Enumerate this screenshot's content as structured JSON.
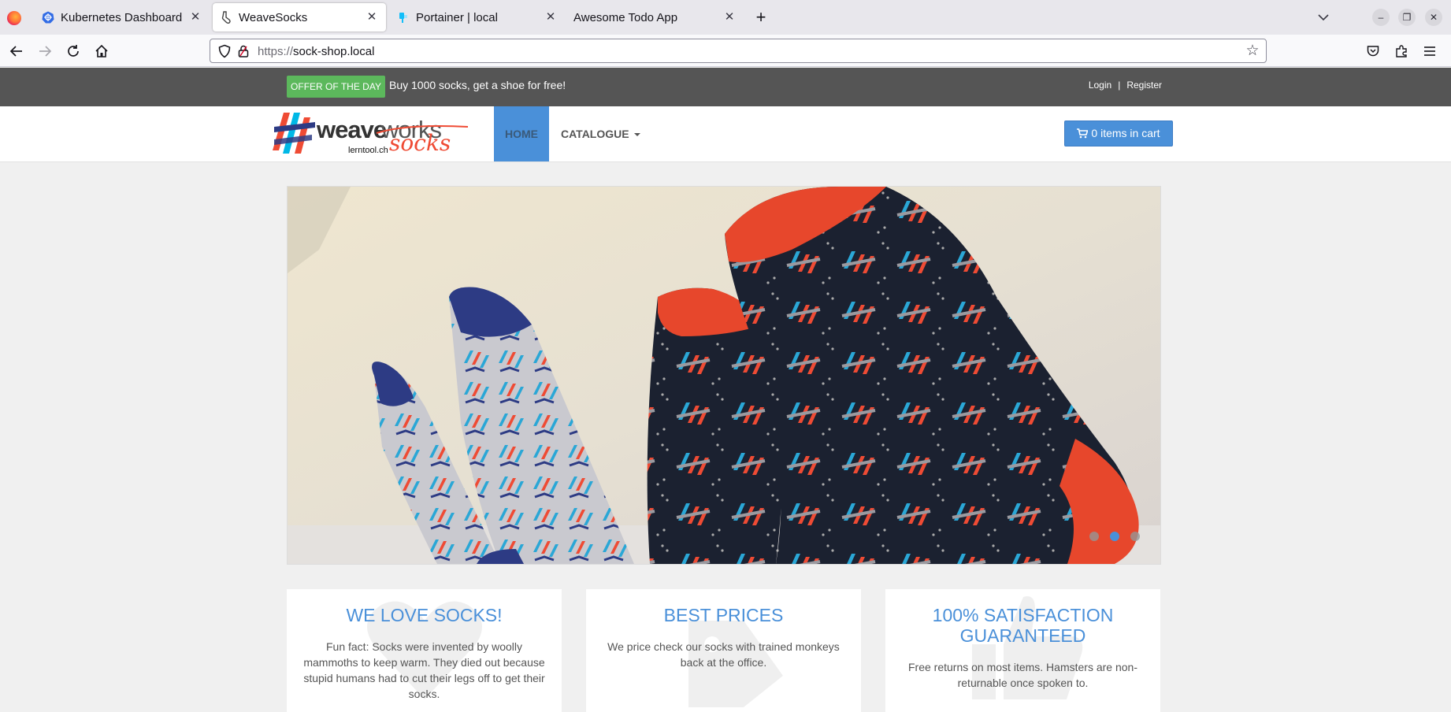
{
  "browser": {
    "tabs": [
      {
        "title": "Kubernetes Dashboard",
        "icon": "kubernetes-icon",
        "active": false
      },
      {
        "title": "WeaveSocks",
        "icon": "weavesocks-icon",
        "active": true
      },
      {
        "title": "Portainer | local",
        "icon": "portainer-icon",
        "active": false
      },
      {
        "title": "Awesome Todo App",
        "icon": "",
        "active": false
      }
    ],
    "url_protocol": "https://",
    "url_host": "sock-shop.local"
  },
  "topbar": {
    "offer_badge": "OFFER OF THE DAY",
    "offer_text": "Buy 1000 socks, get a shoe for free!",
    "login": "Login",
    "separator": "|",
    "register": "Register"
  },
  "header": {
    "logo_word1": "weave",
    "logo_word2": "works",
    "logo_socks": "socks",
    "logo_sub": "lerntool.ch",
    "menu_home": "HOME",
    "menu_catalogue": "CATALOGUE",
    "cart_label": "0 items in cart"
  },
  "carousel": {
    "slides": 3,
    "active_slide": 2
  },
  "features": [
    {
      "title": "WE LOVE SOCKS!",
      "text": "Fun fact: Socks were invented by woolly mammoths to keep warm. They died out because stupid humans had to cut their legs off to get their socks."
    },
    {
      "title": "BEST PRICES",
      "text": "We price check our socks with trained monkeys back at the office."
    },
    {
      "title": "100% SATISFACTION GUARANTEED",
      "text": "Free returns on most items. Hamsters are non-returnable once spoken to."
    }
  ],
  "colors": {
    "accent_blue": "#4a90d9",
    "offer_green": "#5cb85c",
    "topbar_gray": "#555555",
    "logo_red": "#ef4b34"
  }
}
